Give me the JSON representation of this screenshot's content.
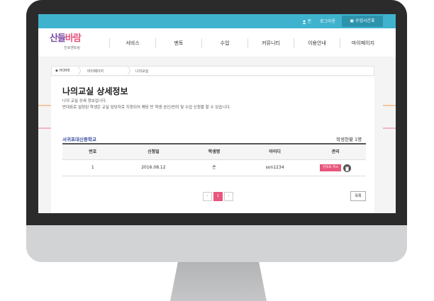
{
  "topbar": {
    "user": "돈",
    "logout": "로그아웃",
    "schedule_button": "수업시간표"
  },
  "logo": {
    "main_a": "산들",
    "main_b": "바람",
    "sub": "진로멘토링"
  },
  "nav": [
    "서비스",
    "멘토",
    "수업",
    "커뮤니티",
    "이용안내",
    "마이페이지"
  ],
  "breadcrumb": [
    "HOME",
    "마이페이지",
    "나의교실"
  ],
  "page": {
    "title": "나의교실 상세정보",
    "sub1": "나의 교실 상세 정보입니다.",
    "sub2": "반대표로 설정된 학생은 교실 담당자로 지정되어 해당 반 학생 승인/반려 및 수업 신청을 할 수 있습니다."
  },
  "school": "서귀포대신중학교",
  "stats": "학생현황 1명",
  "table": {
    "headers": [
      "번호",
      "신청일",
      "학생명",
      "아이디",
      "관리"
    ],
    "rows": [
      {
        "no": "1",
        "date": "2016.08.12",
        "name": "손",
        "id": "son1234",
        "action": "반대표 취소"
      }
    ]
  },
  "pager": {
    "prev": "‹",
    "current": "1",
    "next": "›"
  },
  "list_button": "목록",
  "colors": {
    "accent": "#e8557d",
    "topbar": "#3fb3ce",
    "logo": "#7c4fa5"
  }
}
